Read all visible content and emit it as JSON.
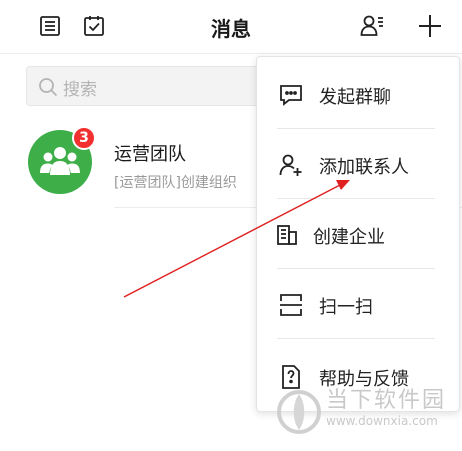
{
  "header": {
    "title": "消息",
    "left_icons": [
      "list-icon",
      "task-check-icon"
    ],
    "right_icons": [
      "contacts-icon",
      "plus-icon"
    ]
  },
  "search": {
    "placeholder": "搜索"
  },
  "conversations": [
    {
      "name": "运营团队",
      "preview": "[运营团队]创建组织",
      "unread": "3",
      "avatar_icon": "group-icon",
      "avatar_color": "#3eae48"
    }
  ],
  "menu": {
    "items": [
      {
        "label": "发起群聊",
        "icon": "group-chat-icon"
      },
      {
        "label": "添加联系人",
        "icon": "add-contact-icon"
      },
      {
        "label": "创建企业",
        "icon": "building-icon"
      },
      {
        "label": "扫一扫",
        "icon": "scan-icon"
      },
      {
        "label": "帮助与反馈",
        "icon": "help-doc-icon"
      }
    ]
  },
  "watermark": {
    "text": "当下软件园",
    "url": "www.downxia.com"
  },
  "colors": {
    "badge": "#f23030",
    "arrow": "#e02020"
  }
}
